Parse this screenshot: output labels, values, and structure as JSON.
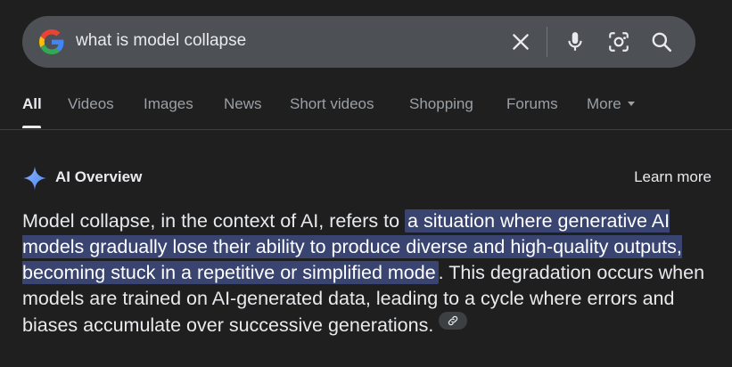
{
  "search": {
    "query": "what is model collapse"
  },
  "icons": {
    "logo": "google-g-icon",
    "clear": "close-icon",
    "mic": "mic-icon",
    "lens": "lens-icon",
    "search": "search-icon",
    "sparkle": "sparkle-icon",
    "link": "link-icon"
  },
  "tabs": [
    {
      "label": "All",
      "active": true
    },
    {
      "label": "Videos"
    },
    {
      "label": "Images"
    },
    {
      "label": "News"
    },
    {
      "label": "Short videos"
    },
    {
      "label": "Shopping"
    },
    {
      "label": "Forums"
    },
    {
      "label": "More"
    }
  ],
  "ai_overview": {
    "title": "AI Overview",
    "learn_more": "Learn more",
    "text_before": "Model collapse, in the context of AI, refers to ",
    "text_highlight": "a situation where generative AI models gradually lose their ability to produce diverse and high-quality outputs, becoming stuck in a repetitive or simplified mode",
    "text_after": ". This degradation occurs when models are trained on AI-generated data, leading to a cycle where errors and biases accumulate over successive generations."
  },
  "colors": {
    "background": "#1f1f1f",
    "search_bar": "#4d5156",
    "highlight": "#394570",
    "text": "#e8eaed",
    "muted_text": "#9aa0a6"
  }
}
